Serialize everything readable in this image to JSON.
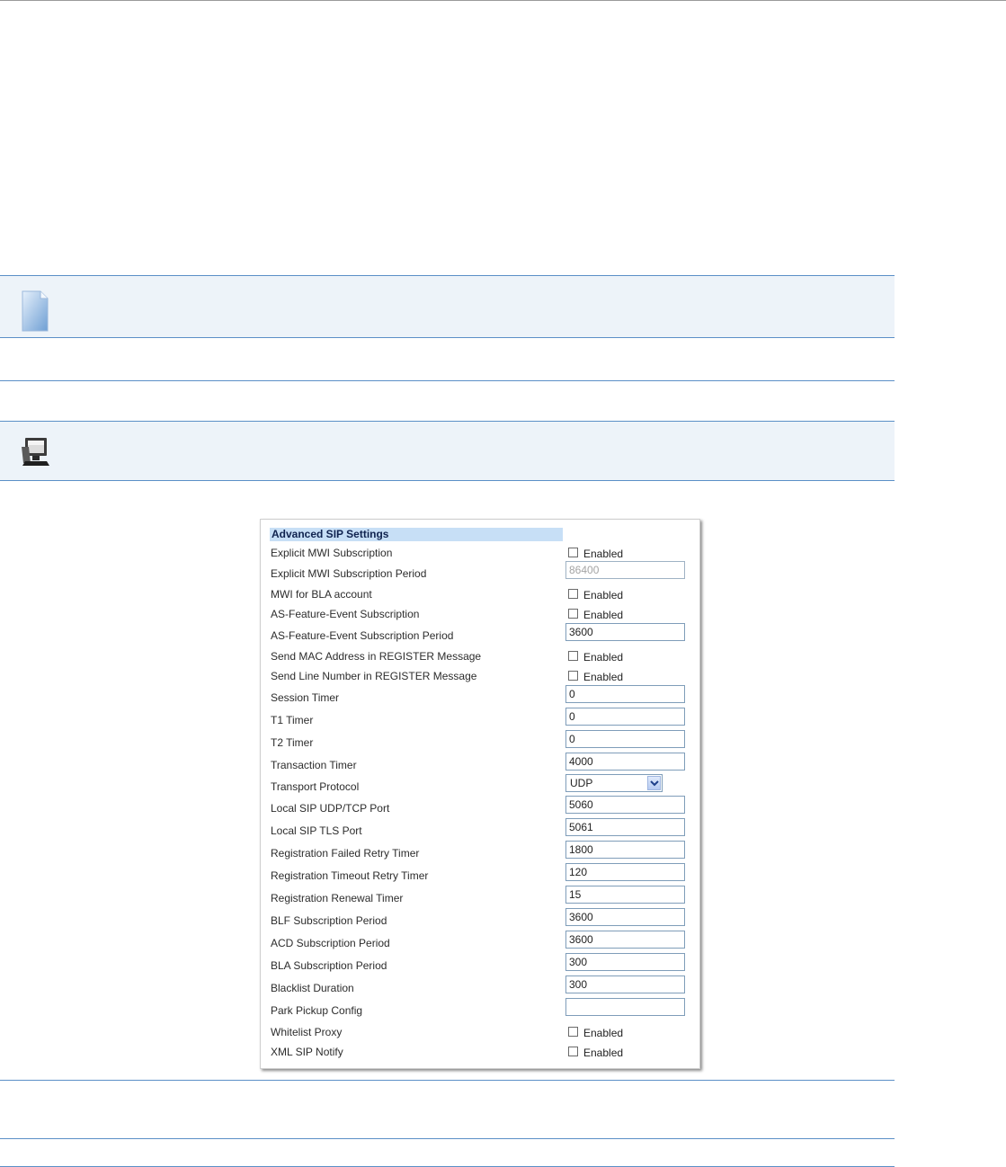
{
  "panel": {
    "title": "Advanced SIP Settings",
    "rows": [
      {
        "label": "Explicit MWI Subscription",
        "control": "checkbox",
        "checkbox_label": "Enabled",
        "checked": false
      },
      {
        "label": "Explicit MWI Subscription Period",
        "control": "text",
        "value": "86400",
        "disabled": true
      },
      {
        "label": "MWI for BLA account",
        "control": "checkbox",
        "checkbox_label": "Enabled",
        "checked": false
      },
      {
        "label": "AS-Feature-Event Subscription",
        "control": "checkbox",
        "checkbox_label": "Enabled",
        "checked": false
      },
      {
        "label": "AS-Feature-Event Subscription Period",
        "control": "text",
        "value": "3600"
      },
      {
        "label": "Send MAC Address in REGISTER Message",
        "control": "checkbox",
        "checkbox_label": "Enabled",
        "checked": false
      },
      {
        "label": "Send Line Number in REGISTER Message",
        "control": "checkbox",
        "checkbox_label": "Enabled",
        "checked": false
      },
      {
        "label": "Session Timer",
        "control": "text",
        "value": "0"
      },
      {
        "label": "T1 Timer",
        "control": "text",
        "value": "0"
      },
      {
        "label": "T2 Timer",
        "control": "text",
        "value": "0"
      },
      {
        "label": "Transaction Timer",
        "control": "text",
        "value": "4000"
      },
      {
        "label": "Transport Protocol",
        "control": "select",
        "value": "UDP"
      },
      {
        "label": "Local SIP UDP/TCP Port",
        "control": "text",
        "value": "5060"
      },
      {
        "label": "Local SIP TLS Port",
        "control": "text",
        "value": "5061"
      },
      {
        "label": "Registration Failed Retry Timer",
        "control": "text",
        "value": "1800"
      },
      {
        "label": "Registration Timeout Retry Timer",
        "control": "text",
        "value": "120"
      },
      {
        "label": "Registration Renewal Timer",
        "control": "text",
        "value": "15"
      },
      {
        "label": "BLF Subscription Period",
        "control": "text",
        "value": "3600"
      },
      {
        "label": "ACD Subscription Period",
        "control": "text",
        "value": "3600"
      },
      {
        "label": "BLA Subscription Period",
        "control": "text",
        "value": "300"
      },
      {
        "label": "Blacklist Duration",
        "control": "text",
        "value": "300"
      },
      {
        "label": "Park Pickup Config",
        "control": "text",
        "value": ""
      },
      {
        "label": "Whitelist Proxy",
        "control": "checkbox",
        "checkbox_label": "Enabled",
        "checked": false
      },
      {
        "label": "XML SIP Notify",
        "control": "checkbox",
        "checkbox_label": "Enabled",
        "checked": false
      }
    ]
  },
  "icons": {
    "note": "note-document-icon",
    "web_ui": "computer-monitor-icon"
  },
  "colors": {
    "rule": "#5b8fc7",
    "band": "#edf3f9",
    "title_bg": "#c7dff6"
  }
}
